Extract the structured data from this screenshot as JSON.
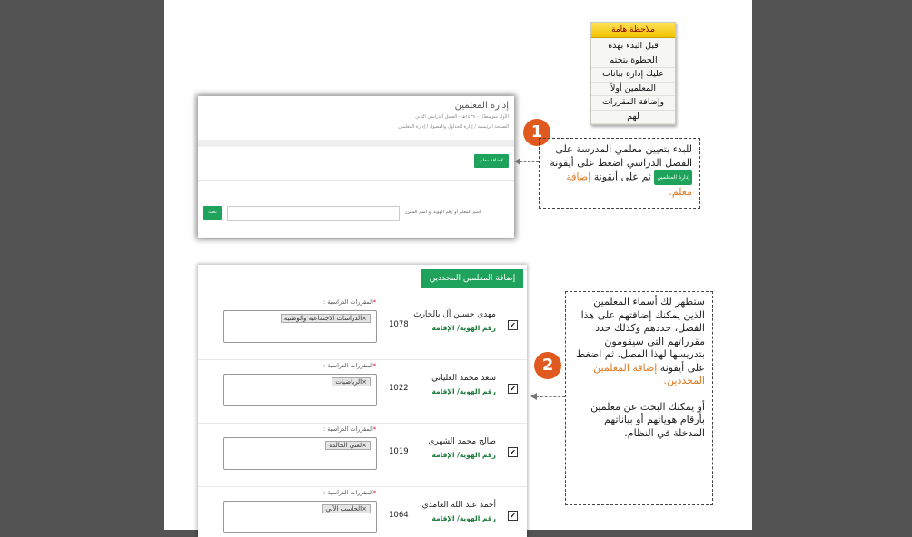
{
  "note": {
    "title": "ملاحظة هامة",
    "lines": [
      "قبل البدء بهذه",
      "الخطوة يتحتم",
      "عليك إدارة بيانات",
      "المعلمين أولاً",
      "وإضافة المقررات",
      "لهم"
    ]
  },
  "shot1": {
    "title": "إدارة المعلمين",
    "subtitle": "الأول متوسط/١ - ١٤٣٩هـ - الفصل الدراسي الثاني",
    "breadcrumb": "الصفحة الرئيسية  /  إدارة الجداول والفصول  /  إدارة المعلمين",
    "add_button": "لإضافة معلم",
    "search_label": "اسم المعلم أو رقم الهوية أو اسم المقرر",
    "search_button": "بحث"
  },
  "steps": {
    "one": "1",
    "two": "2"
  },
  "box1": {
    "text_a": "للبدء بتعيين معلمي المدرسة على الفصل الدراسي اضغط على أيقونة",
    "chip": "إدارة المعلمين",
    "text_b": "ثم على أيقونة",
    "highlight": "إضافة معلم."
  },
  "box2": {
    "para1": "ستظهر لك أسماء المعلمين الذين يمكنك إضافتهم على هذا الفصل، حددهم وكذلك حدد مقرراتهم التي سيقومون بتدريسها لهذا الفصل. ثم اضغط على أيقونة",
    "highlight": "إضافة المعلمين المحددين.",
    "para2": "أو يمكنك البحث عن معلمين بأرقام هوياتهم أو بياناتهم المدخلة في النظام."
  },
  "shot2": {
    "header_button": "إضافة المعلمين المحددين",
    "courses_label": "المقررات الدراسية :",
    "id_label": "رقم الهوية/ الإقامة",
    "teachers": [
      {
        "name": "مهدي حسين آل بالحارث",
        "number": "1078",
        "course": "×الدراسات الاجتماعية والوطنية",
        "checked": "✔"
      },
      {
        "name": "سعد محمد العلياني",
        "number": "1022",
        "course": "×الرياضيات",
        "checked": "✔"
      },
      {
        "name": "صالح محمد الشهري",
        "number": "1019",
        "course": "×لغتي الخالدة",
        "checked": "✔"
      },
      {
        "name": "أحمد عبد الله الغامدي",
        "number": "1064",
        "course": "×الحاسب الآلي",
        "checked": "✔"
      }
    ]
  },
  "colors": {
    "accent_green": "#1fa35c",
    "step_orange": "#e05a1f",
    "highlight_orange": "#e0781f"
  }
}
